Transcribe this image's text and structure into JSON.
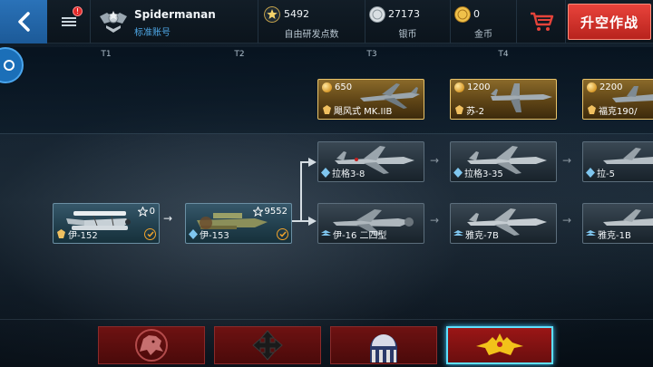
{
  "header": {
    "username": "Spidermanan",
    "account_type": "标准账号",
    "notification_count": "!",
    "research_points": {
      "value": "5492",
      "label": "自由研发点数"
    },
    "silver": {
      "value": "27173",
      "label": "银币"
    },
    "gold": {
      "value": "0",
      "label": "金币"
    },
    "sortie_label": "升空作战"
  },
  "tiers": [
    "T1",
    "T2",
    "T3",
    "T4"
  ],
  "premium": [
    {
      "price": "650",
      "name": "飓风式 MK.IIB"
    },
    {
      "price": "1200",
      "name": "苏-2"
    },
    {
      "price": "2200",
      "name": "福克190/"
    }
  ],
  "tree": {
    "t1": {
      "name": "伊-152",
      "rp": "0",
      "owned": true
    },
    "t2": {
      "name": "伊-153",
      "rp": "9552",
      "owned": true
    },
    "t3_top": {
      "name": "拉格3-8"
    },
    "t3_bottom": {
      "name": "伊-16 二四型"
    },
    "t4_top": {
      "name": "拉格3-35"
    },
    "t4_bottom": {
      "name": "雅克-7B"
    },
    "t5_top": {
      "name": "拉-5"
    },
    "t5_bottom": {
      "name": "雅克-1B"
    }
  },
  "nations": [
    "britain",
    "germany",
    "usa",
    "ussr"
  ],
  "colors": {
    "accent_blue": "#2a72b8",
    "sortie_red": "#d8322b",
    "premium_gold": "#e8c36a",
    "active_tab_glow": "#5fe0ff"
  }
}
